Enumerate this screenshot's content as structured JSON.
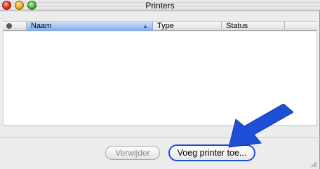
{
  "window": {
    "title": "Printers"
  },
  "table": {
    "columns": [
      "Naam",
      "Type",
      "Status"
    ]
  },
  "buttons": {
    "remove_label": "Verwijder",
    "add_label": "Voeg printer toe..."
  },
  "colors": {
    "highlight": "#1f4fd6",
    "selected_column": "#7fa9e6"
  }
}
